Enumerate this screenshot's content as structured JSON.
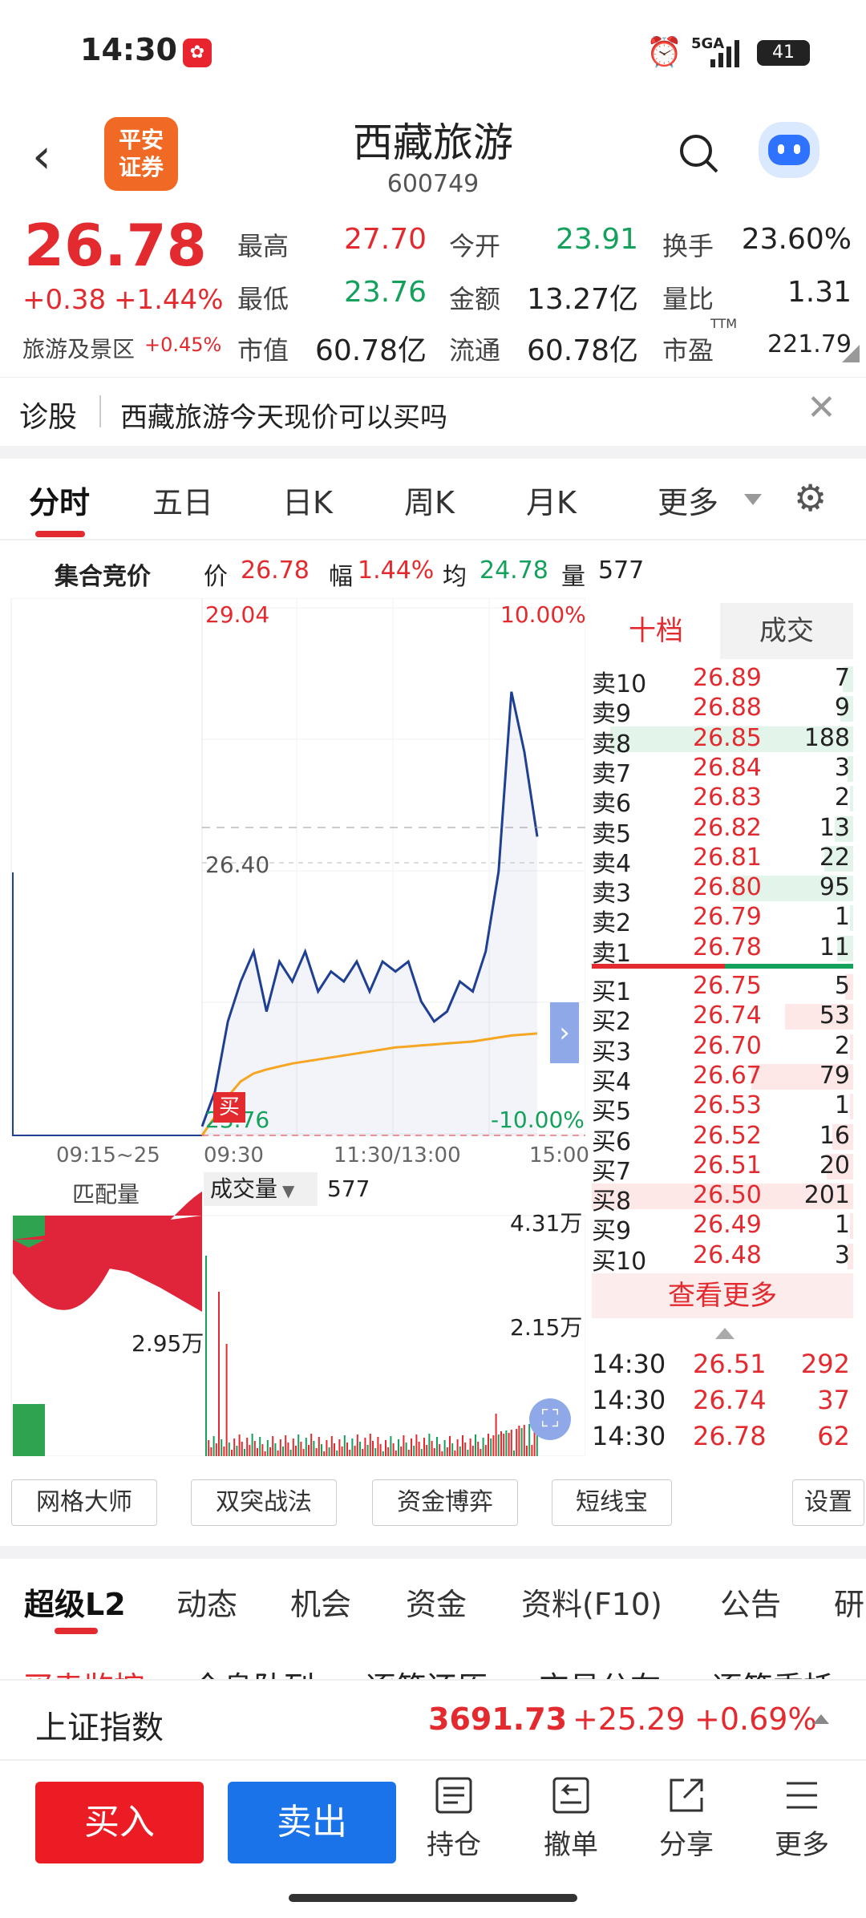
{
  "status_bar": {
    "time": "14:30",
    "network": "5GA",
    "battery": "41"
  },
  "header": {
    "broker_logo_text": "平安\n证券",
    "title": "西藏旅游",
    "code": "600749"
  },
  "quote": {
    "price": "26.78",
    "change": "+0.38",
    "change_pct": "+1.44%",
    "sector": "旅游及景区",
    "sector_pct": "+0.45%",
    "labels": {
      "high": "最高",
      "low": "最低",
      "mktcap": "市值",
      "open": "今开",
      "amount": "金额",
      "float": "流通",
      "turnover": "换手",
      "vol_ratio": "量比",
      "pe": "市盈",
      "pe_sup": "TTM"
    },
    "values": {
      "high": "27.70",
      "low": "23.76",
      "mktcap": "60.78亿",
      "open": "23.91",
      "amount": "13.27亿",
      "float": "60.78亿",
      "turnover": "23.60%",
      "vol_ratio": "1.31",
      "pe": "221.79"
    }
  },
  "diagnosis": {
    "label": "诊股",
    "question": "西藏旅游今天现价可以买吗"
  },
  "kline_tabs": [
    "分时",
    "五日",
    "日K",
    "周K",
    "月K",
    "更多"
  ],
  "info_line": {
    "auction": "集合竞价",
    "price_label": "价",
    "price": "26.78",
    "range_label": "幅",
    "range": "1.44%",
    "avg_label": "均",
    "avg": "24.78",
    "vol_label": "量",
    "vol": "577"
  },
  "chart_labels": {
    "top_price": "29.04",
    "top_pct": "10.00%",
    "mid_price": "26.40",
    "bottom_price": "23.76",
    "bottom_pct": "-10.00%",
    "x_labels": [
      "09:15~25",
      "09:30",
      "11:30/13:00",
      "15:00"
    ],
    "match_vol": "匹配量",
    "volume_tab": "成交量",
    "volume_value": "577",
    "vol_top": "4.31万",
    "vol_mid": "2.15万",
    "match_peak": "2.95万",
    "buy_marker": "买"
  },
  "chart_data": {
    "type": "line",
    "title": "",
    "x_ticks": [
      "09:30",
      "11:30/13:00",
      "15:00"
    ],
    "ylim": [
      23.76,
      29.04
    ],
    "series": [
      {
        "name": "价",
        "values": [
          23.85,
          24.2,
          24.9,
          25.3,
          25.6,
          25.0,
          25.5,
          25.3,
          25.6,
          25.2,
          25.4,
          25.3,
          25.5,
          25.2,
          25.5,
          25.4,
          25.5,
          25.1,
          24.9,
          25.0,
          25.3,
          25.2,
          25.6,
          26.4,
          28.2,
          27.6,
          26.75
        ]
      },
      {
        "name": "均",
        "values": [
          23.76,
          23.95,
          24.15,
          24.3,
          24.38,
          24.42,
          24.45,
          24.48,
          24.5,
          24.52,
          24.54,
          24.56,
          24.58,
          24.6,
          24.62,
          24.64,
          24.65,
          24.66,
          24.67,
          24.68,
          24.69,
          24.7,
          24.72,
          24.74,
          24.76,
          24.77,
          24.78
        ]
      }
    ]
  },
  "orderbook": {
    "tab_active": "十档",
    "tab_trades": "成交",
    "asks": [
      {
        "label": "卖10",
        "price": "26.89",
        "vol": "7",
        "level": 0.04
      },
      {
        "label": "卖9",
        "price": "26.88",
        "vol": "9",
        "level": 0.05
      },
      {
        "label": "卖8",
        "price": "26.85",
        "vol": "188",
        "level": 0.93
      },
      {
        "label": "卖7",
        "price": "26.84",
        "vol": "3",
        "level": 0.02
      },
      {
        "label": "卖6",
        "price": "26.83",
        "vol": "2",
        "level": 0.01
      },
      {
        "label": "卖5",
        "price": "26.82",
        "vol": "13",
        "level": 0.07
      },
      {
        "label": "卖4",
        "price": "26.81",
        "vol": "22",
        "level": 0.11
      },
      {
        "label": "卖3",
        "price": "26.80",
        "vol": "95",
        "level": 0.47
      },
      {
        "label": "卖2",
        "price": "26.79",
        "vol": "1",
        "level": 0.01
      },
      {
        "label": "卖1",
        "price": "26.78",
        "vol": "11",
        "level": 0.06
      }
    ],
    "bids": [
      {
        "label": "买1",
        "price": "26.75",
        "vol": "5",
        "level": 0.03
      },
      {
        "label": "买2",
        "price": "26.74",
        "vol": "53",
        "level": 0.26
      },
      {
        "label": "买3",
        "price": "26.70",
        "vol": "2",
        "level": 0.01
      },
      {
        "label": "买4",
        "price": "26.67",
        "vol": "79",
        "level": 0.39
      },
      {
        "label": "买5",
        "price": "26.53",
        "vol": "1",
        "level": 0.01
      },
      {
        "label": "买6",
        "price": "26.52",
        "vol": "16",
        "level": 0.08
      },
      {
        "label": "买7",
        "price": "26.51",
        "vol": "20",
        "level": 0.1
      },
      {
        "label": "买8",
        "price": "26.50",
        "vol": "201",
        "level": 1.0
      },
      {
        "label": "买9",
        "price": "26.49",
        "vol": "1",
        "level": 0.01
      },
      {
        "label": "买10",
        "price": "26.48",
        "vol": "3",
        "level": 0.02
      }
    ],
    "more": "查看更多",
    "trades": [
      {
        "time": "14:30",
        "price": "26.51",
        "vol": "292"
      },
      {
        "time": "14:30",
        "price": "26.74",
        "vol": "37"
      },
      {
        "time": "14:30",
        "price": "26.78",
        "vol": "62"
      }
    ]
  },
  "tools": [
    "网格大师",
    "双突战法",
    "资金博弈",
    "短线宝",
    "设置"
  ],
  "bottom_tabs": [
    "超级L2",
    "动态",
    "机会",
    "资金",
    "资料(F10)",
    "公告",
    "研"
  ],
  "sub_tabs_partial": [
    "买卖监控",
    "全息队列",
    "逐笔还原",
    "交易分布",
    "逐笔委托"
  ],
  "index_bar": {
    "name": "上证指数",
    "value": "3691.73",
    "change": "+25.29",
    "pct": "+0.69%"
  },
  "actions": {
    "buy": "买入",
    "sell": "卖出",
    "holdings": "持仓",
    "cancel": "撤单",
    "share": "分享",
    "more": "更多"
  },
  "colors": {
    "up": "#e32a2f",
    "down": "#14a15c",
    "blue_btn": "#1a73e8",
    "line": "#1f3f93",
    "avg": "#f5a623"
  }
}
